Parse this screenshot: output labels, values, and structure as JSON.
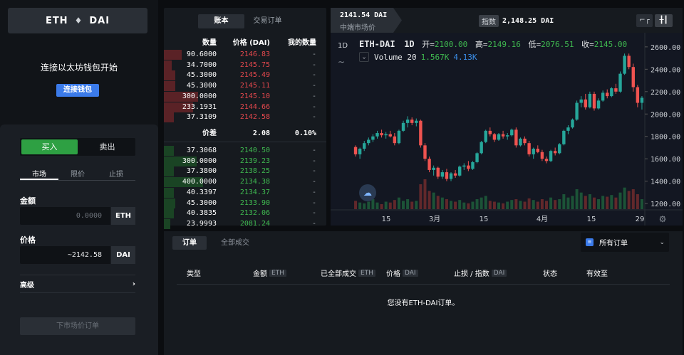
{
  "left": {
    "pair": {
      "base": "ETH",
      "quote": "DAI",
      "eth_glyph": "♦"
    },
    "connect_title": "连接以太坊钱包开始",
    "connect_button": "连接钱包",
    "buy": "买入",
    "sell": "卖出",
    "order_types": [
      "市场",
      "限价",
      "止损"
    ],
    "amount_label": "金额",
    "amount_placeholder": "0.0000",
    "amount_unit": "ETH",
    "price_label": "价格",
    "price_value": "~2142.58",
    "price_unit": "DAI",
    "advanced": "高级",
    "place_order": "下市场价订单"
  },
  "book": {
    "tabs": [
      "账本",
      "交易订单"
    ],
    "headers": {
      "qty": "数量",
      "price": "价格 (DAI)",
      "mine": "我的数量"
    },
    "asks": [
      {
        "q": "90.6000",
        "p": "2146.83",
        "m": "-",
        "d": 0.11
      },
      {
        "q": "34.7000",
        "p": "2145.75",
        "m": "-",
        "d": 0.05
      },
      {
        "q": "45.3000",
        "p": "2145.49",
        "m": "-",
        "d": 0.07
      },
      {
        "q": "45.3000",
        "p": "2145.11",
        "m": "-",
        "d": 0.07
      },
      {
        "q": "300.0000",
        "p": "2145.10",
        "m": "-",
        "d": 0.21
      },
      {
        "q": "233.1931",
        "p": "2144.66",
        "m": "-",
        "d": 0.18
      },
      {
        "q": "37.3109",
        "p": "2142.58",
        "m": "-",
        "d": 0.06
      }
    ],
    "spread": {
      "label": "价差",
      "value": "2.08",
      "pct": "0.10%"
    },
    "bids": [
      {
        "q": "37.3068",
        "p": "2140.50",
        "m": "-",
        "d": 0.06
      },
      {
        "q": "300.0000",
        "p": "2139.23",
        "m": "-",
        "d": 0.2
      },
      {
        "q": "37.3800",
        "p": "2138.25",
        "m": "-",
        "d": 0.06
      },
      {
        "q": "400.0000",
        "p": "2134.38",
        "m": "-",
        "d": 0.24
      },
      {
        "q": "40.3397",
        "p": "2134.37",
        "m": "-",
        "d": 0.06
      },
      {
        "q": "45.3000",
        "p": "2133.90",
        "m": "-",
        "d": 0.07
      },
      {
        "q": "40.3835",
        "p": "2132.06",
        "m": "-",
        "d": 0.06
      },
      {
        "q": "23.9993",
        "p": "2081.24",
        "m": "-",
        "d": 0.04
      }
    ]
  },
  "chart": {
    "price_main": "2141.54 DAI",
    "price_sub": "中端市场价",
    "index_label": "指数",
    "index_value": "2,148.25 DAI",
    "ctrl1": "⌐┌",
    "ctrl2": "╂┃",
    "timeframe": "1D",
    "tilde": "∼",
    "symbol": "ETH-DAI",
    "interval": "1D",
    "ohlc": {
      "o_label": "开=",
      "o": "2100.00",
      "h_label": "高=",
      "h": "2149.16",
      "l_label": "低=",
      "l": "2076.51",
      "c_label": "收=",
      "c": "2145.00"
    },
    "volume_label": "Volume 20",
    "volume_box": "⌄",
    "vol1": "1.567K",
    "vol2": "4.13K",
    "logo_glyph": "☁",
    "up_color": "#26a69a",
    "down_color": "#ef5350"
  },
  "chart_data": {
    "type": "candlestick",
    "title": "ETH-DAI 1D",
    "y_ticks": [
      "2600.00",
      "2400.00",
      "2200.00",
      "2000.00",
      "1800.00",
      "1600.00",
      "1400.00",
      "1200.00"
    ],
    "y_range": [
      1150,
      2650
    ],
    "x_ticks": [
      "15",
      "3月",
      "15",
      "4月",
      "15",
      "29"
    ],
    "series": [
      {
        "name": "ETH-DAI",
        "ohlc": [
          [
            1705,
            1720,
            1620,
            1640
          ],
          [
            1640,
            1700,
            1600,
            1690
          ],
          [
            1690,
            1760,
            1670,
            1740
          ],
          [
            1740,
            1790,
            1720,
            1770
          ],
          [
            1770,
            1820,
            1750,
            1800
          ],
          [
            1800,
            1850,
            1780,
            1830
          ],
          [
            1830,
            1860,
            1790,
            1810
          ],
          [
            1810,
            1840,
            1780,
            1820
          ],
          [
            1820,
            1850,
            1790,
            1800
          ],
          [
            1800,
            1830,
            1720,
            1740
          ],
          [
            1740,
            1860,
            1730,
            1850
          ],
          [
            1850,
            1940,
            1840,
            1920
          ],
          [
            1920,
            1980,
            1880,
            1950
          ],
          [
            1950,
            1970,
            1900,
            1920
          ],
          [
            1920,
            1960,
            1890,
            1940
          ],
          [
            1940,
            1950,
            1700,
            1720
          ],
          [
            1720,
            1740,
            1580,
            1600
          ],
          [
            1600,
            1620,
            1480,
            1500
          ],
          [
            1500,
            1540,
            1450,
            1520
          ],
          [
            1520,
            1530,
            1420,
            1440
          ],
          [
            1440,
            1500,
            1420,
            1480
          ],
          [
            1480,
            1510,
            1400,
            1420
          ],
          [
            1420,
            1480,
            1400,
            1470
          ],
          [
            1470,
            1500,
            1430,
            1450
          ],
          [
            1450,
            1540,
            1440,
            1530
          ],
          [
            1530,
            1560,
            1500,
            1540
          ],
          [
            1540,
            1580,
            1490,
            1510
          ],
          [
            1510,
            1580,
            1500,
            1570
          ],
          [
            1570,
            1660,
            1560,
            1650
          ],
          [
            1650,
            1760,
            1640,
            1750
          ],
          [
            1750,
            1860,
            1740,
            1850
          ],
          [
            1850,
            1880,
            1800,
            1820
          ],
          [
            1820,
            1830,
            1750,
            1770
          ],
          [
            1770,
            1830,
            1760,
            1820
          ],
          [
            1820,
            1850,
            1780,
            1800
          ],
          [
            1800,
            1830,
            1770,
            1810
          ],
          [
            1810,
            1870,
            1800,
            1860
          ],
          [
            1860,
            1880,
            1700,
            1720
          ],
          [
            1720,
            1790,
            1710,
            1780
          ],
          [
            1780,
            1800,
            1720,
            1740
          ],
          [
            1740,
            1760,
            1620,
            1640
          ],
          [
            1640,
            1700,
            1600,
            1690
          ],
          [
            1690,
            1720,
            1650,
            1660
          ],
          [
            1660,
            1680,
            1580,
            1600
          ],
          [
            1600,
            1620,
            1560,
            1580
          ],
          [
            1580,
            1680,
            1570,
            1670
          ],
          [
            1670,
            1700,
            1630,
            1650
          ],
          [
            1650,
            1740,
            1640,
            1730
          ],
          [
            1730,
            1860,
            1720,
            1850
          ],
          [
            1850,
            1900,
            1820,
            1880
          ],
          [
            1880,
            1960,
            1870,
            1950
          ],
          [
            1950,
            2120,
            1940,
            2100
          ],
          [
            2100,
            2160,
            2060,
            2130
          ],
          [
            2130,
            2180,
            2040,
            2060
          ],
          [
            2060,
            2200,
            2050,
            2180
          ],
          [
            2180,
            2200,
            2030,
            2050
          ],
          [
            2050,
            2140,
            2040,
            2120
          ],
          [
            2120,
            2210,
            2110,
            2190
          ],
          [
            2190,
            2220,
            2140,
            2160
          ],
          [
            2160,
            2240,
            2150,
            2230
          ],
          [
            2230,
            2270,
            2180,
            2200
          ],
          [
            2200,
            2380,
            2190,
            2360
          ],
          [
            2360,
            2540,
            2350,
            2520
          ],
          [
            2520,
            2540,
            2400,
            2420
          ],
          [
            2420,
            2450,
            2200,
            2240
          ],
          [
            2240,
            2260,
            2060,
            2100
          ],
          [
            2100,
            2160,
            2040,
            2145
          ]
        ]
      }
    ],
    "volumes": [
      10,
      8,
      7,
      9,
      12,
      8,
      6,
      9,
      8,
      11,
      14,
      10,
      12,
      9,
      10,
      30,
      36,
      22,
      20,
      16,
      14,
      12,
      10,
      9,
      11,
      8,
      7,
      9,
      12,
      14,
      16,
      10,
      9,
      8,
      7,
      9,
      11,
      12,
      10,
      9,
      13,
      11,
      9,
      12,
      10,
      14,
      11,
      12,
      18,
      14,
      16,
      24,
      20,
      16,
      18,
      14,
      12,
      16,
      15,
      17,
      14,
      20,
      26,
      22,
      24,
      18,
      12
    ]
  },
  "orders": {
    "tabs": [
      "订单",
      "全部成交"
    ],
    "filter": "所有订单",
    "filter_icon": "≡",
    "filter_chev": "⌄",
    "headers": {
      "type": "类型",
      "amount": "金额",
      "amount_unit": "ETH",
      "filled": "已全部成交",
      "filled_unit": "ETH",
      "price": "价格",
      "price_unit": "DAI",
      "stop": "止损 / 指数",
      "stop_unit": "DAI",
      "status": "状态",
      "expiry": "有效至"
    },
    "empty": "您没有ETH-DAI订单。"
  }
}
